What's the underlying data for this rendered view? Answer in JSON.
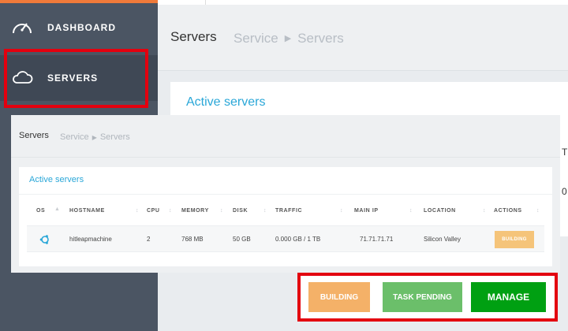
{
  "sidebar": {
    "items": [
      {
        "label": "DASHBOARD",
        "icon": "gauge-icon"
      },
      {
        "label": "SERVERS",
        "icon": "cloud-icon"
      }
    ]
  },
  "header": {
    "title": "Servers",
    "breadcrumb": [
      "Service",
      "Servers"
    ]
  },
  "card": {
    "title": "Active servers"
  },
  "right_edge": {
    "header_letter": "T",
    "cell_digit": "0"
  },
  "inset": {
    "header": {
      "title": "Servers",
      "breadcrumb": [
        "Service",
        "Servers"
      ]
    },
    "card_title": "Active servers",
    "columns": [
      "OS",
      "HOSTNAME",
      "CPU",
      "MEMORY",
      "DISK",
      "TRAFFIC",
      "MAIN IP",
      "LOCATION",
      "ACTIONS"
    ],
    "rows": [
      {
        "os_icon": "ubuntu-icon",
        "hostname": "hitleapmachine",
        "cpu": "2",
        "memory": "768 MB",
        "disk": "50 GB",
        "traffic": "0.000 GB / 1 TB",
        "main_ip": "71.71.71.71",
        "location": "Silicon Valley",
        "action": "BUILDING"
      }
    ]
  },
  "action_buttons": {
    "building": "BUILDING",
    "task_pending": "TASK PENDING",
    "manage": "MANAGE"
  },
  "colors": {
    "sidebar": "#4b5563",
    "accent_blue": "#2aa7d8",
    "highlight_red": "#e3000f",
    "building": "#f4b168",
    "task_pending": "#6bbf6a",
    "manage": "#00a012"
  }
}
